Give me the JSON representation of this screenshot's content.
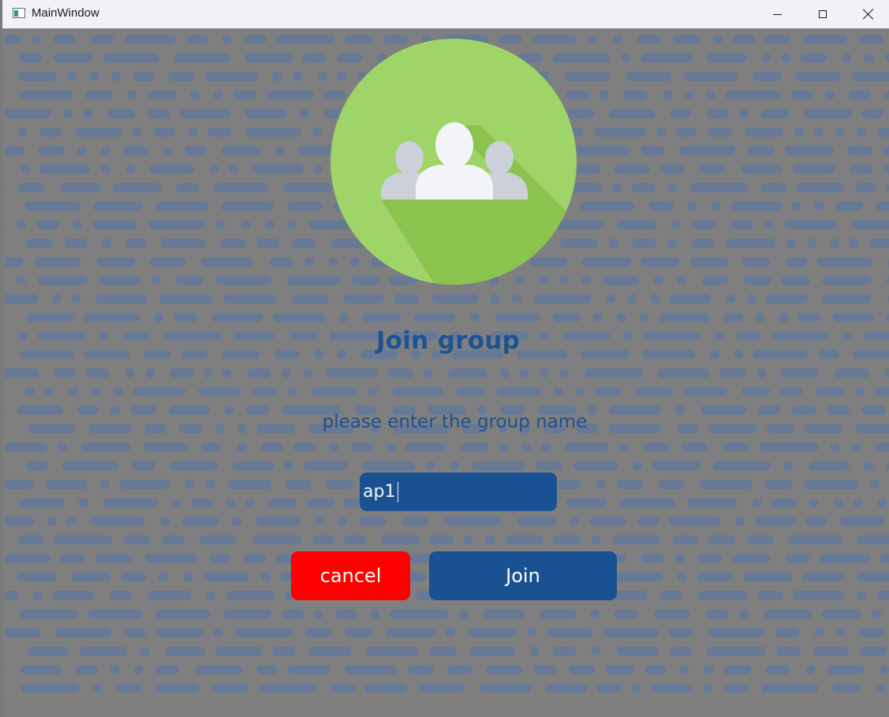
{
  "window": {
    "title": "MainWindow",
    "controls": {
      "minimize_icon": "minimize-icon",
      "maximize_icon": "maximize-icon",
      "close_icon": "close-icon"
    }
  },
  "main": {
    "logo_icon": "group-users-icon",
    "heading": "Join group",
    "prompt": "please enter the group name",
    "group_name_value": "ap1",
    "cancel_label": "cancel",
    "join_label": "Join"
  },
  "colors": {
    "heading": "#1c5393",
    "input_bg": "#1a5192",
    "cancel_bg": "#ff0000",
    "join_bg": "#1a5192",
    "logo_circle": "#9fd468",
    "logo_shadow": "#8bc34f"
  }
}
